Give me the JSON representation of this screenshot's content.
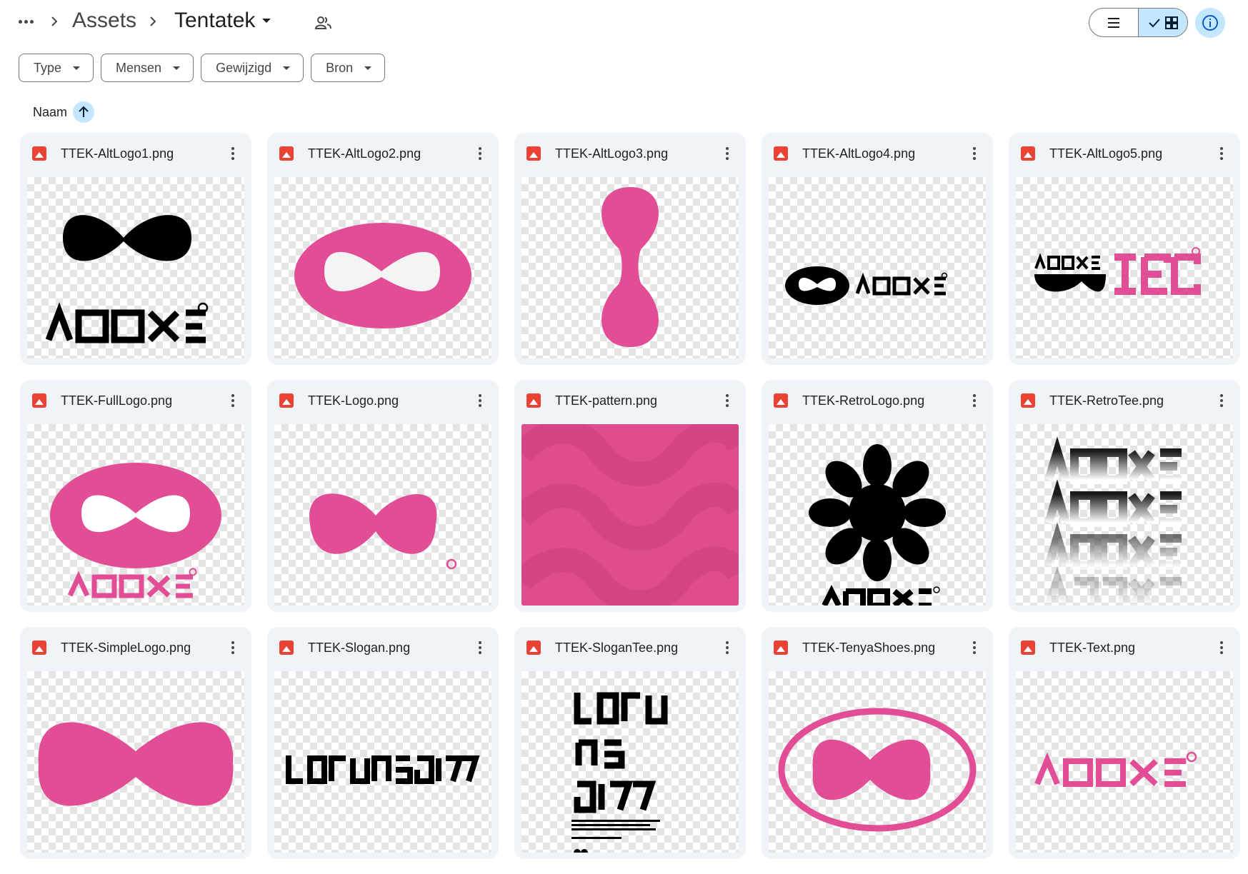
{
  "breadcrumb": {
    "more_icon": "more-horiz-icon",
    "items": [
      "Assets",
      "Tentatek"
    ],
    "shared_icon": "people-icon"
  },
  "view": {
    "list_icon": "list-icon",
    "grid_icon": "grid-icon",
    "selected": "grid",
    "info_icon": "info-icon"
  },
  "filters": [
    {
      "label": "Type"
    },
    {
      "label": "Mensen"
    },
    {
      "label": "Gewijzigd"
    },
    {
      "label": "Bron"
    }
  ],
  "sort": {
    "label": "Naam",
    "direction": "ascending",
    "icon": "arrow-up-icon"
  },
  "colors": {
    "accent_light": "#c2e7ff",
    "card_bg": "#f0f4f9",
    "brand_pink": "#e24e96",
    "file_icon_red": "#ea4335"
  },
  "files": [
    {
      "name": "TTEK-AltLogo1.png"
    },
    {
      "name": "TTEK-AltLogo2.png"
    },
    {
      "name": "TTEK-AltLogo3.png"
    },
    {
      "name": "TTEK-AltLogo4.png"
    },
    {
      "name": "TTEK-AltLogo5.png"
    },
    {
      "name": "TTEK-FullLogo.png"
    },
    {
      "name": "TTEK-Logo.png"
    },
    {
      "name": "TTEK-pattern.png"
    },
    {
      "name": "TTEK-RetroLogo.png"
    },
    {
      "name": "TTEK-RetroTee.png"
    },
    {
      "name": "TTEK-SimpleLogo.png"
    },
    {
      "name": "TTEK-Slogan.png"
    },
    {
      "name": "TTEK-SloganTee.png"
    },
    {
      "name": "TTEK-TenyaShoes.png"
    },
    {
      "name": "TTEK-Text.png"
    }
  ]
}
